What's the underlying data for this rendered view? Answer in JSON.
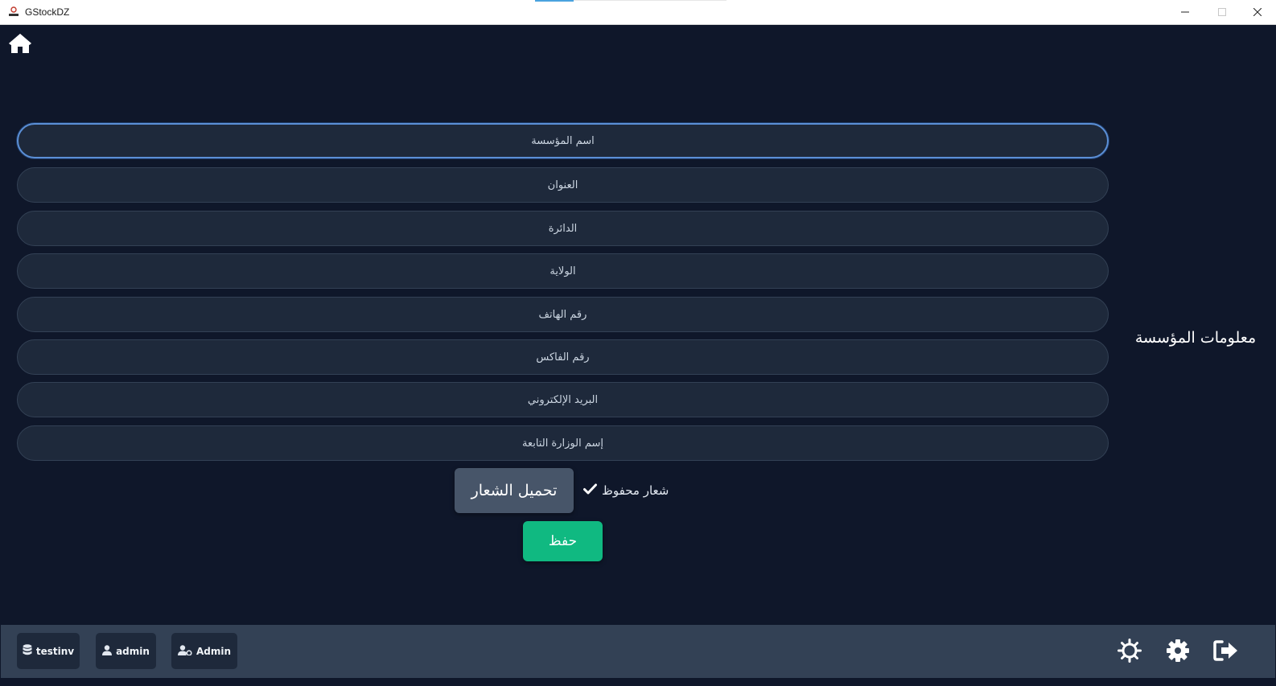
{
  "window": {
    "title": "GStockDZ"
  },
  "form": {
    "section_title": "معلومات المؤسسة",
    "fields": [
      {
        "placeholder": "اسم المؤسسة",
        "value": ""
      },
      {
        "placeholder": "العنوان",
        "value": ""
      },
      {
        "placeholder": "الدائرة",
        "value": ""
      },
      {
        "placeholder": "الولاية",
        "value": ""
      },
      {
        "placeholder": "رقم الهاتف",
        "value": ""
      },
      {
        "placeholder": "رقم الفاكس",
        "value": ""
      },
      {
        "placeholder": "البريد الإلكتروني",
        "value": ""
      },
      {
        "placeholder": "إسم الوزارة التابعة",
        "value": ""
      }
    ],
    "upload_logo_label": "تحميل الشعار",
    "logo_saved_label": "شعار محفوظ",
    "save_label": "حفظ"
  },
  "bottom_bar": {
    "database_label": "testinv",
    "user_label": "admin",
    "role_label": "Admin"
  },
  "icons": {
    "home": "home-icon",
    "check": "check-icon",
    "database": "database-icon",
    "user": "user-icon",
    "user_role": "user-cog-icon",
    "theme": "sun-icon",
    "settings": "gear-icon",
    "logout": "logout-icon"
  },
  "colors": {
    "background": "#0f172a",
    "field_bg": "#1e293b",
    "bottom_bar": "#334155",
    "save_button": "#10b981",
    "upload_button": "#475569",
    "focus_border": "#5b8fd6"
  }
}
